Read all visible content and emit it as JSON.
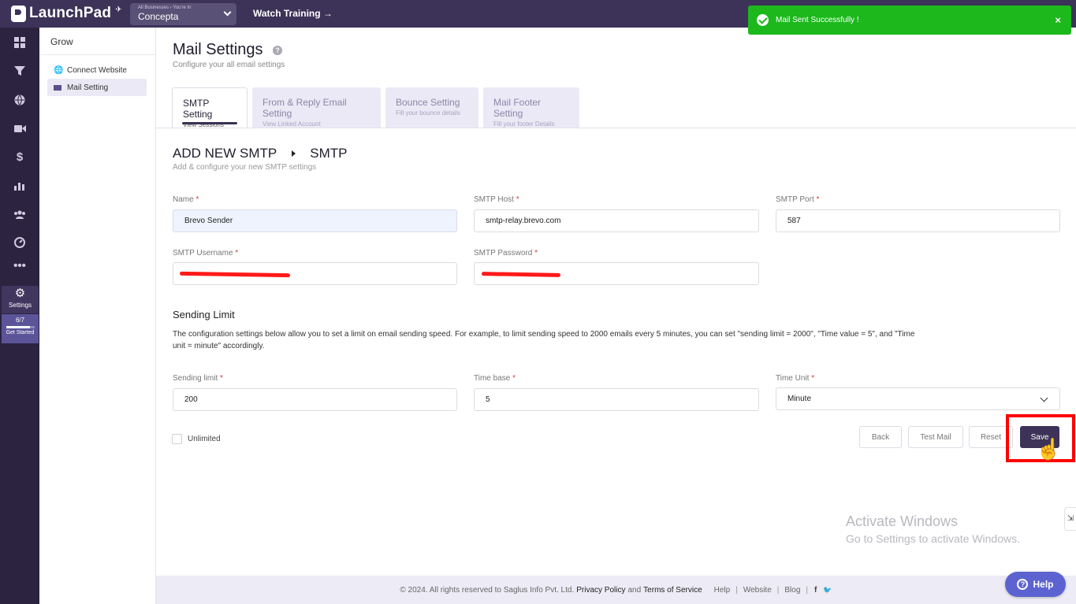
{
  "brand": {
    "name": "LaunchPad"
  },
  "topbar": {
    "business_crumb": "All Businesses › You're In",
    "business_name": "Concepta",
    "watch_training": "Watch Training →"
  },
  "toast": {
    "message": "Mail Sent Successfully !",
    "close": "×",
    "color": "#1cb81c"
  },
  "sidebar": {
    "icons": [
      "dashboard-icon",
      "funnel-icon",
      "globe-icon",
      "video-icon",
      "dollar-icon",
      "chart-icon",
      "users-icon",
      "gauge-icon",
      "more-icon"
    ],
    "settings_label": "Settings",
    "progress_text": "6/7",
    "progress_fraction": 0.857,
    "get_started": "Get Started"
  },
  "subnav": {
    "title": "Grow",
    "items": [
      {
        "label": "Connect Website",
        "active": false
      },
      {
        "label": "Mail Setting",
        "active": true
      }
    ]
  },
  "page": {
    "title": "Mail Settings",
    "help": "?",
    "subtitle": "Configure your all email settings"
  },
  "tabs": [
    {
      "title": "SMTP Setting",
      "sub": "View Sessions"
    },
    {
      "title": "From & Reply Email Setting",
      "sub": "View Linked Account"
    },
    {
      "title": "Bounce Setting",
      "sub": "Fill your bounce details"
    },
    {
      "title": "Mail Footer Setting",
      "sub": "Fill your footer Details"
    }
  ],
  "section": {
    "title_left": "ADD NEW SMTP",
    "title_right": "SMTP",
    "subtitle": "Add & configure your new SMTP settings"
  },
  "fields": {
    "name": {
      "label": "Name",
      "value": "Brevo Sender"
    },
    "smtp_host": {
      "label": "SMTP Host",
      "value": "smtp-relay.brevo.com"
    },
    "smtp_port": {
      "label": "SMTP Port",
      "value": "587"
    },
    "smtp_username": {
      "label": "SMTP Username",
      "value": ""
    },
    "smtp_password": {
      "label": "SMTP Password",
      "value": ""
    },
    "sending_limit": {
      "label": "Sending limit",
      "value": "200"
    },
    "time_base": {
      "label": "Time base",
      "value": "5"
    },
    "time_unit": {
      "label": "Time Unit",
      "value": "Minute"
    },
    "required_mark": "*"
  },
  "sending_limit": {
    "title": "Sending Limit",
    "description": "The configuration settings below allow you to set a limit on email sending speed. For example, to limit sending speed to 2000 emails every 5 minutes, you can set \"sending limit = 2000\", \"Time value = 5\", and \"Time unit = minute\" accordingly."
  },
  "unlimited_label": "Unlimited",
  "buttons": {
    "back": "Back",
    "test_mail": "Test Mail",
    "reset": "Reset",
    "save": "Save"
  },
  "watermark": {
    "line1": "Activate Windows",
    "line2": "Go to Settings to activate Windows."
  },
  "footer": {
    "copyright": "© 2024. All rights reserved to Saglus Info Pvt. Ltd.",
    "privacy": "Privacy Policy",
    "and": "and",
    "terms": "Terms of Service",
    "help": "Help",
    "website": "Website",
    "blog": "Blog",
    "sep": "|",
    "facebook": "f",
    "twitter": "🐦"
  },
  "help_button": "Help",
  "colors": {
    "brand": "#3d3358",
    "sidebar": "#2b2340",
    "accent": "#5c63d1",
    "highlight": "#ff0000"
  }
}
